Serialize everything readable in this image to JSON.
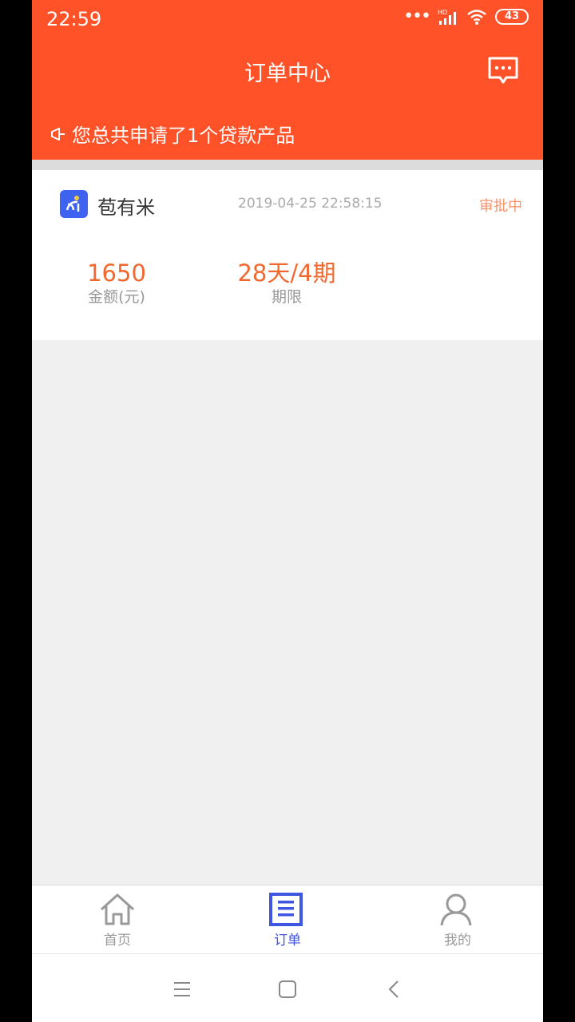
{
  "status_bar": {
    "time": "22:59",
    "battery": "43",
    "signal_label": "HD"
  },
  "header": {
    "title": "订单中心",
    "notice": "您总共申请了1个贷款产品"
  },
  "order": {
    "app_name": "苞有米",
    "time": "2019-04-25 22:58:15",
    "status": "审批中",
    "amount": {
      "value": "1650",
      "label": "金额(元)"
    },
    "term": {
      "value": "28天/4期",
      "label": "期限"
    }
  },
  "tabbar": {
    "tabs": [
      {
        "label": "首页",
        "icon": "home-icon",
        "active": false
      },
      {
        "label": "订单",
        "icon": "orders-icon",
        "active": true
      },
      {
        "label": "我的",
        "icon": "profile-icon",
        "active": false
      }
    ]
  },
  "colors": {
    "header": "#ff5229",
    "accent_orange": "#f1672e",
    "status_orange": "#f6956d",
    "active_tab": "#3f56e0"
  }
}
